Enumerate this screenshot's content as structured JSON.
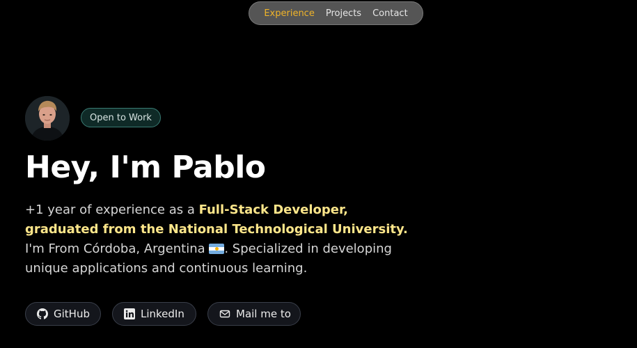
{
  "nav": {
    "items": [
      {
        "label": "Experience",
        "active": true
      },
      {
        "label": "Projects",
        "active": false
      },
      {
        "label": "Contact",
        "active": false
      }
    ],
    "active_color": "#f0b429"
  },
  "hero": {
    "status_badge": "Open to Work",
    "title": "Hey, I'm Pablo",
    "intro": {
      "part1": "+1 year of experience as a ",
      "highlight": "Full-Stack Developer, graduated from the National Technological University.",
      "part2": " I'm From Córdoba, Argentina ",
      "flag_icon": "argentina-flag-icon",
      "part3": ". Specialized in developing unique applications and continuous learning."
    },
    "highlight_color": "#fde68a"
  },
  "links": {
    "github": {
      "label": "GitHub",
      "icon": "github-icon"
    },
    "linkedin": {
      "label": "LinkedIn",
      "icon": "linkedin-icon"
    },
    "mail": {
      "label": "Mail me to",
      "icon": "mail-icon"
    }
  }
}
